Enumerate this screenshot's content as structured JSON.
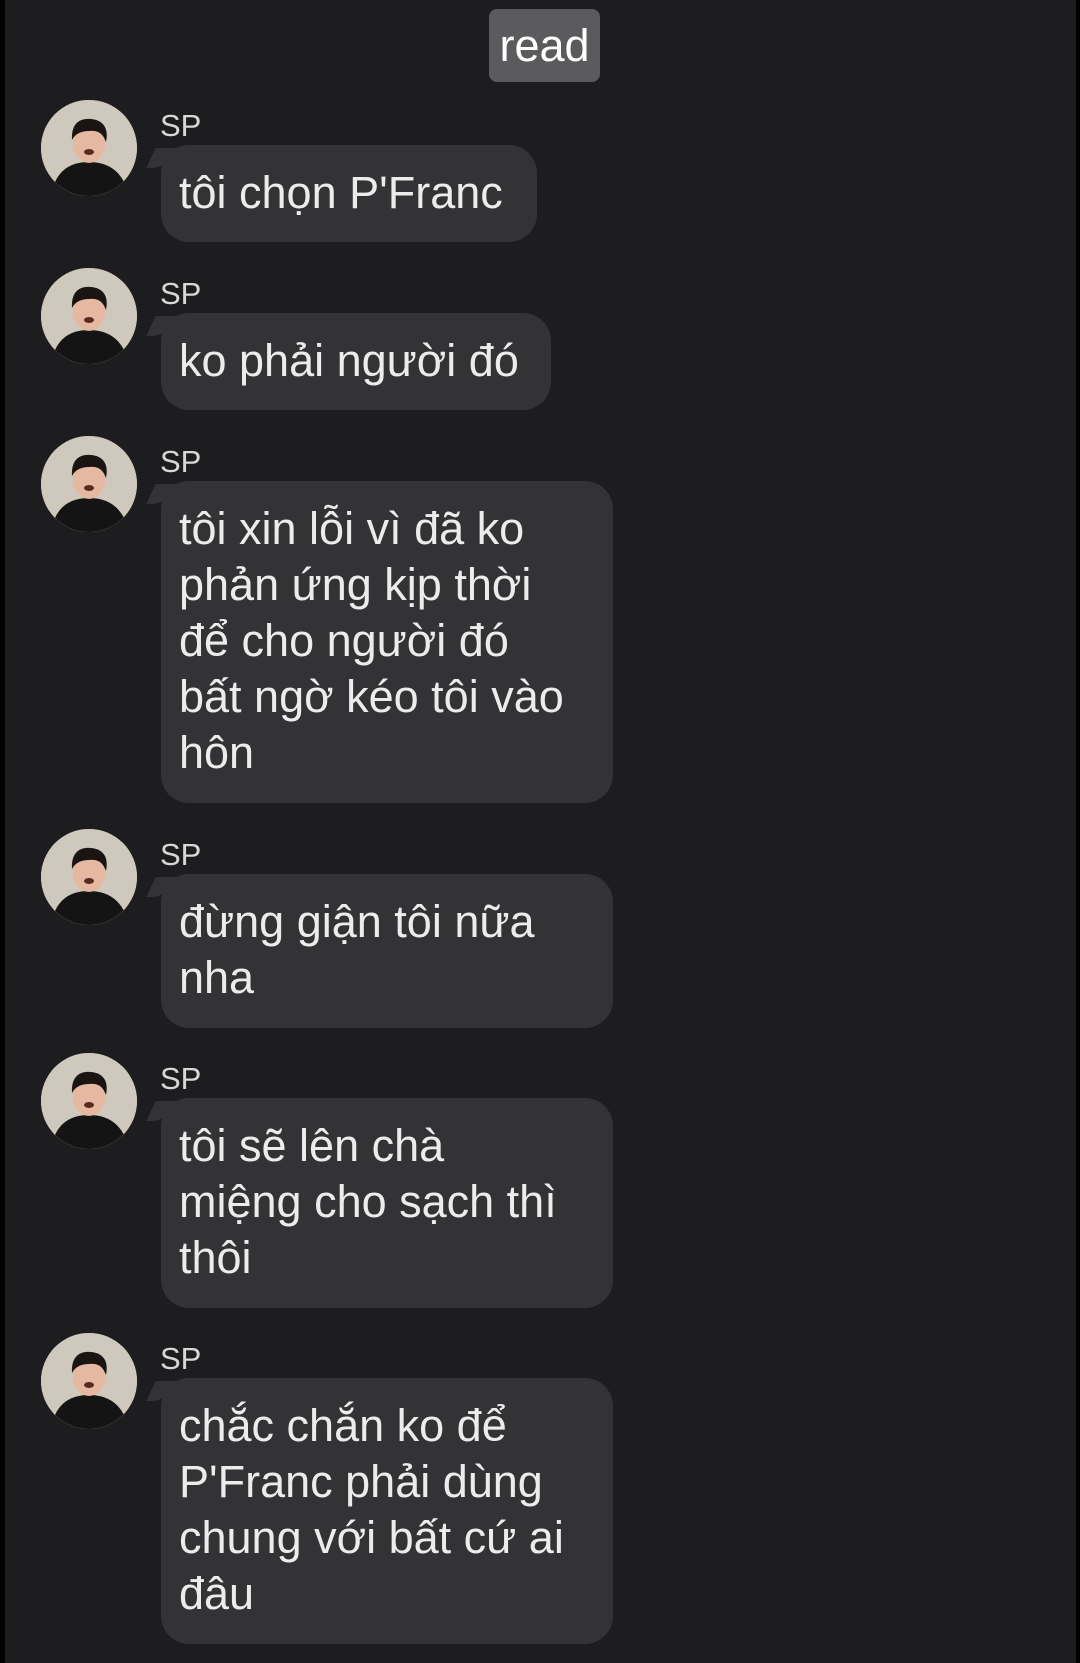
{
  "status": {
    "read_label": "read"
  },
  "messages": [
    {
      "sender": "SP",
      "text": "tôi chọn P'Franc"
    },
    {
      "sender": "SP",
      "text": "ko phải người đó"
    },
    {
      "sender": "SP",
      "text": "tôi xin lỗi vì đã ko\nphản ứng kịp thời\nđể cho người đó\nbất ngờ kéo tôi vào\nhôn"
    },
    {
      "sender": "SP",
      "text": "đừng giận tôi nữa\nnha"
    },
    {
      "sender": "SP",
      "text": "tôi sẽ lên chà\nmiệng cho sạch thì\nthôi"
    },
    {
      "sender": "SP",
      "text": "chắc chắn ko để\nP'Franc phải dùng\nchung với bất cứ ai\nđâu"
    }
  ],
  "colors": {
    "background": "#1d1d1f",
    "bubble": "#333335",
    "read_chip": "#5b5b5e"
  },
  "icons": {
    "avatar": "profile-photo"
  }
}
